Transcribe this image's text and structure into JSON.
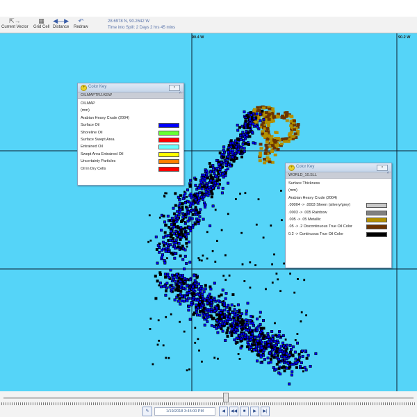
{
  "toolbar": {
    "tools": [
      {
        "label": "Current Vector",
        "icon": "current-vector-icon"
      },
      {
        "label": "Grid Cell",
        "icon": "grid-cell-icon"
      },
      {
        "label": "Distance",
        "icon": "distance-icon"
      },
      {
        "label": "Redraw",
        "icon": "redraw-icon"
      }
    ],
    "coords": "28.6978 N, 90.2642 W",
    "time_into_spill": "Time into Spill: 2 Days 2 hrs 45 mins"
  },
  "map": {
    "ocean_color": "#55d4f8",
    "gridline_color": "#0b1c2b",
    "lon_labels": [
      "90.4 W",
      "90.2 W"
    ]
  },
  "color_key_1": {
    "title": "Color Key",
    "name": "OILMAPTRJ.KEW",
    "lines": [
      "OILMAP",
      "(mm)",
      "Arabian Heavy Crude (2004)"
    ],
    "items": [
      {
        "label": "Surface Oil",
        "color": "#0000ff"
      },
      {
        "label": "Shoreline Oil",
        "color": "#66ff33"
      },
      {
        "label": "Surface Swept Area",
        "color": "#ff0000"
      },
      {
        "label": "Entrained Oil",
        "color": "#66ffff"
      },
      {
        "label": "Swept Area Entrained Oil",
        "color": "#ffff00"
      },
      {
        "label": "Uncertainty Particles",
        "color": "#ff8000"
      },
      {
        "label": "Oil in Dry Cells",
        "color": "#ff0000"
      }
    ]
  },
  "color_key_2": {
    "title": "Color Key",
    "name": "WORLD_10.SLL",
    "lines": [
      "Surface Thickness",
      "(mm)",
      "Arabian Heavy Crude (2004)"
    ],
    "items": [
      {
        "label": ".00004 -> .0003 Sheen (silvery/grey)",
        "color": "#c8c8c8"
      },
      {
        "label": ".0003 -> .005 Rainbow",
        "color": "#808080"
      },
      {
        "label": ".005 -> .05 Metallic",
        "color": "#b38f00"
      },
      {
        "label": ".05 -> .2 Discontinuous True Oil Color",
        "color": "#6b3300"
      },
      {
        "label": "0.2 -> Continuous True Oil Color",
        "color": "#000000"
      }
    ]
  },
  "timeline": {
    "timestamp": "1/19/2018 3:45:00 PM",
    "position": 0.54
  }
}
